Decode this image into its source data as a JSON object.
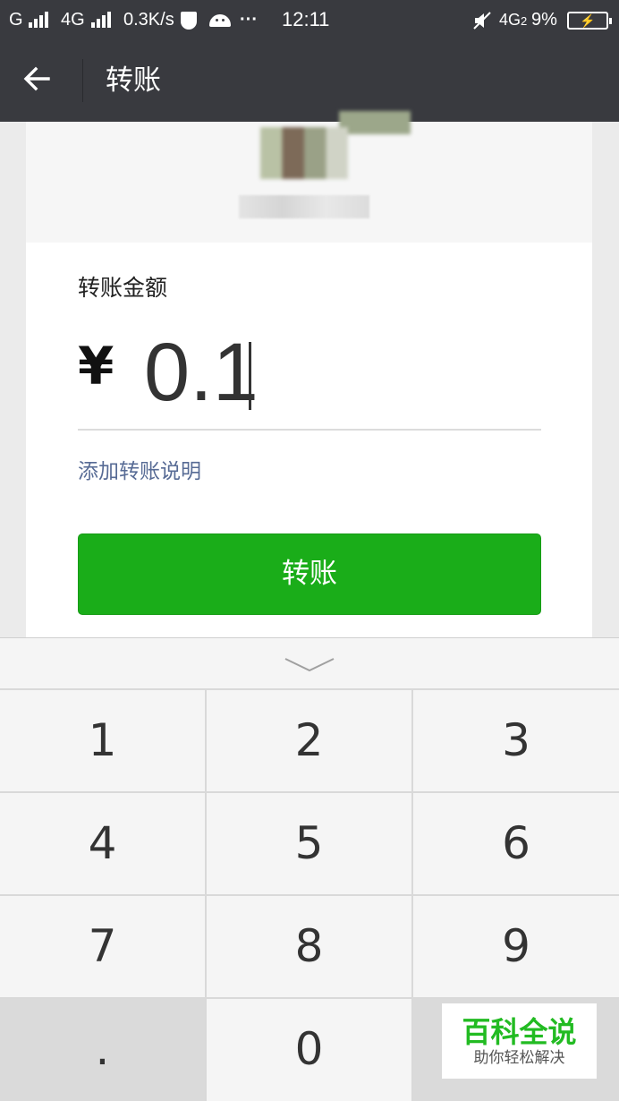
{
  "status_bar": {
    "carrier1": "G",
    "carrier2": "4G",
    "speed": "0.3K/s",
    "dots": "···",
    "time": "12:11",
    "net": "4G",
    "net_sub": "2",
    "battery": "9%"
  },
  "title_bar": {
    "title": "转账"
  },
  "form": {
    "amount_label": "转账金额",
    "currency": "¥",
    "amount_value": "0.1",
    "add_note": "添加转账说明",
    "submit_label": "转账"
  },
  "keypad": {
    "keys": [
      "1",
      "2",
      "3",
      "4",
      "5",
      "6",
      "7",
      "8",
      "9",
      ".",
      "0"
    ]
  },
  "watermark": {
    "title": "百科全说",
    "subtitle": "助你轻松解决"
  },
  "colors": {
    "header_bg": "#393a3f",
    "primary_button": "#1aad19",
    "link": "#576b95",
    "watermark_green": "#22bb22"
  }
}
